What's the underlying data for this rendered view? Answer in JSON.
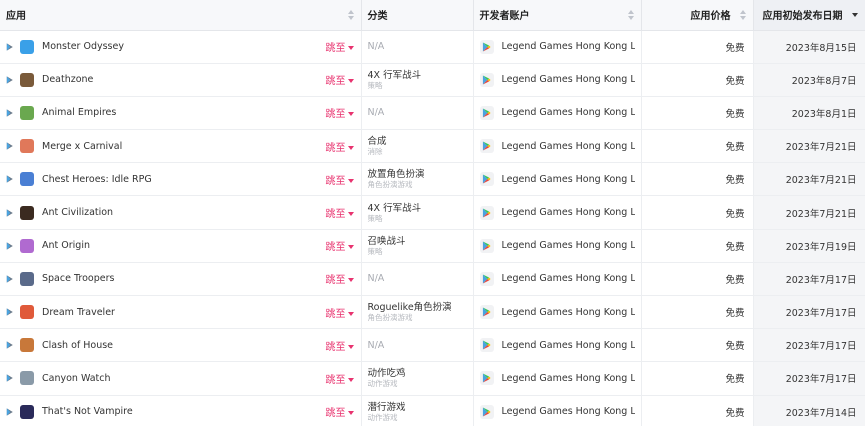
{
  "headers": {
    "app": "应用",
    "category": "分类",
    "developer": "开发者账户",
    "price": "应用价格",
    "release_date": "应用初始发布日期"
  },
  "jump_label": "跳至",
  "rows": [
    {
      "name": "Monster Odyssey",
      "icon_color": "#3aa0e8",
      "category_main": "N/A",
      "category_sub": "",
      "developer": "Legend Games Hong Kong Limit",
      "price": "免费",
      "date": "2023年8月15日"
    },
    {
      "name": "Deathzone",
      "icon_color": "#7a5a3a",
      "category_main": "4X 行军战斗",
      "category_sub": "策略",
      "developer": "Legend Games Hong Kong Limit",
      "price": "免费",
      "date": "2023年8月7日"
    },
    {
      "name": "Animal Empires",
      "icon_color": "#6aa84f",
      "category_main": "N/A",
      "category_sub": "",
      "developer": "Legend Games Hong Kong Limit",
      "price": "免费",
      "date": "2023年8月1日"
    },
    {
      "name": "Merge x Carnival",
      "icon_color": "#e0785a",
      "category_main": "合成",
      "category_sub": "消除",
      "developer": "Legend Games Hong Kong Limit",
      "price": "免费",
      "date": "2023年7月21日"
    },
    {
      "name": "Chest Heroes: Idle RPG",
      "icon_color": "#4a7fd4",
      "category_main": "放置角色扮演",
      "category_sub": "角色扮演游戏",
      "developer": "Legend Games Hong Kong Limit",
      "price": "免费",
      "date": "2023年7月21日"
    },
    {
      "name": "Ant Civilization",
      "icon_color": "#3b2a20",
      "category_main": "4X 行军战斗",
      "category_sub": "策略",
      "developer": "Legend Games Hong Kong Limit",
      "price": "免费",
      "date": "2023年7月21日"
    },
    {
      "name": "Ant Origin",
      "icon_color": "#b06ad0",
      "category_main": "召唤战斗",
      "category_sub": "策略",
      "developer": "Legend Games Hong Kong Limit",
      "price": "免费",
      "date": "2023年7月19日"
    },
    {
      "name": "Space Troopers",
      "icon_color": "#5a6a8a",
      "category_main": "N/A",
      "category_sub": "",
      "developer": "Legend Games Hong Kong Limit",
      "price": "免费",
      "date": "2023年7月17日"
    },
    {
      "name": "Dream Traveler",
      "icon_color": "#e05a3a",
      "category_main": "Roguelike角色扮演",
      "category_sub": "角色扮演游戏",
      "developer": "Legend Games Hong Kong Limit",
      "price": "免费",
      "date": "2023年7月17日"
    },
    {
      "name": "Clash of House",
      "icon_color": "#c8783a",
      "category_main": "N/A",
      "category_sub": "",
      "developer": "Legend Games Hong Kong Limit",
      "price": "免费",
      "date": "2023年7月17日"
    },
    {
      "name": "Canyon Watch",
      "icon_color": "#8a9aa8",
      "category_main": "动作吃鸡",
      "category_sub": "动作游戏",
      "developer": "Legend Games Hong Kong Limit",
      "price": "免费",
      "date": "2023年7月17日"
    },
    {
      "name": "That's Not Vampire",
      "icon_color": "#2a2a5a",
      "category_main": "潜行游戏",
      "category_sub": "动作游戏",
      "developer": "Legend Games Hong Kong Limit",
      "price": "免费",
      "date": "2023年7月14日"
    }
  ]
}
